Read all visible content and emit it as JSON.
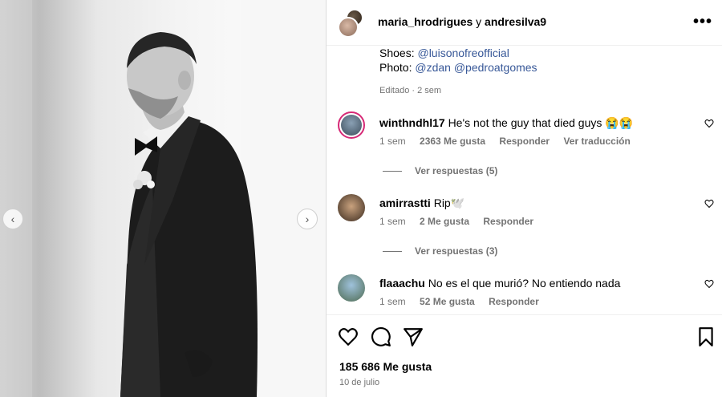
{
  "header": {
    "user1": "maria_hrodrigues",
    "joiner": "y",
    "user2": "andresilva9",
    "more_icon": "more-horizontal-icon"
  },
  "caption": {
    "shoes_label": "Shoes:",
    "shoes_handle": "@luisonofreofficial",
    "photo_label": "Photo:",
    "photo_handle1": "@zdan",
    "photo_handle2": "@pedroatgomes",
    "edited": "Editado · 2 sem"
  },
  "comments": [
    {
      "user": "winthndhl17",
      "text": "He's not the guy that died guys 😭😭",
      "time": "1 sem",
      "likes": "2363 Me gusta",
      "reply": "Responder",
      "translate": "Ver traducción",
      "view_replies": "Ver respuestas (5)"
    },
    {
      "user": "amirrastti",
      "text": "Rip🕊️",
      "time": "1 sem",
      "likes": "2 Me gusta",
      "reply": "Responder",
      "view_replies": "Ver respuestas (3)"
    },
    {
      "user": "flaaachu",
      "text": "No es el que murió? No entiendo nada",
      "time": "1 sem",
      "likes": "52 Me gusta",
      "reply": "Responder"
    }
  ],
  "footer": {
    "likes": "185 686 Me gusta",
    "date": "10 de julio"
  },
  "icons": {
    "like": "heart-icon",
    "comment": "comment-bubble-icon",
    "share": "paper-plane-icon",
    "save": "bookmark-icon",
    "prev": "chevron-left-icon",
    "next": "chevron-right-icon"
  }
}
